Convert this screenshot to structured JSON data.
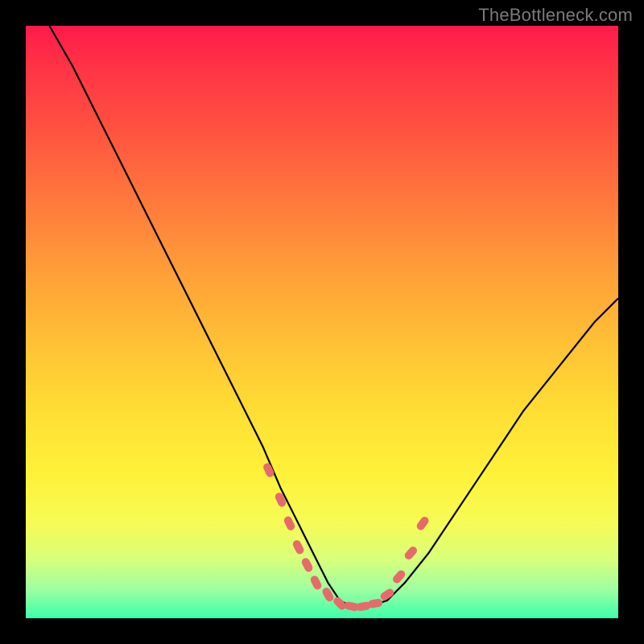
{
  "watermark": {
    "text": "TheBottleneck.com"
  },
  "chart_data": {
    "type": "line",
    "title": "",
    "xlabel": "",
    "ylabel": "",
    "xlim": [
      0,
      100
    ],
    "ylim": [
      0,
      100
    ],
    "grid": false,
    "legend": false,
    "series": [
      {
        "name": "bottleneck-curve",
        "color": "#000000",
        "x": [
          4,
          8,
          12,
          16,
          20,
          24,
          28,
          32,
          36,
          40,
          43,
          46,
          49,
          51,
          53,
          55,
          58,
          61,
          64,
          68,
          72,
          76,
          80,
          84,
          88,
          92,
          96,
          100
        ],
        "y": [
          100,
          93,
          85,
          77,
          69,
          61,
          53,
          45,
          37,
          29,
          22,
          16,
          10,
          6,
          3,
          2,
          2,
          3,
          6,
          11,
          17,
          23,
          29,
          35,
          40,
          45,
          50,
          54
        ]
      }
    ],
    "markers": [
      {
        "name": "highlight-dots",
        "color": "#e76a6a",
        "shape": "rounded-pill",
        "x": [
          41,
          43,
          44.5,
          46,
          47.5,
          49,
          51,
          53,
          55,
          57,
          59,
          61,
          63,
          65,
          67
        ],
        "y": [
          25,
          20,
          16,
          12,
          9,
          6,
          4,
          2.5,
          2,
          2,
          2.5,
          4,
          7,
          11,
          16
        ]
      }
    ],
    "background_gradient": {
      "top_color": "#ff1a4b",
      "bottom_color": "#3bffab"
    }
  }
}
